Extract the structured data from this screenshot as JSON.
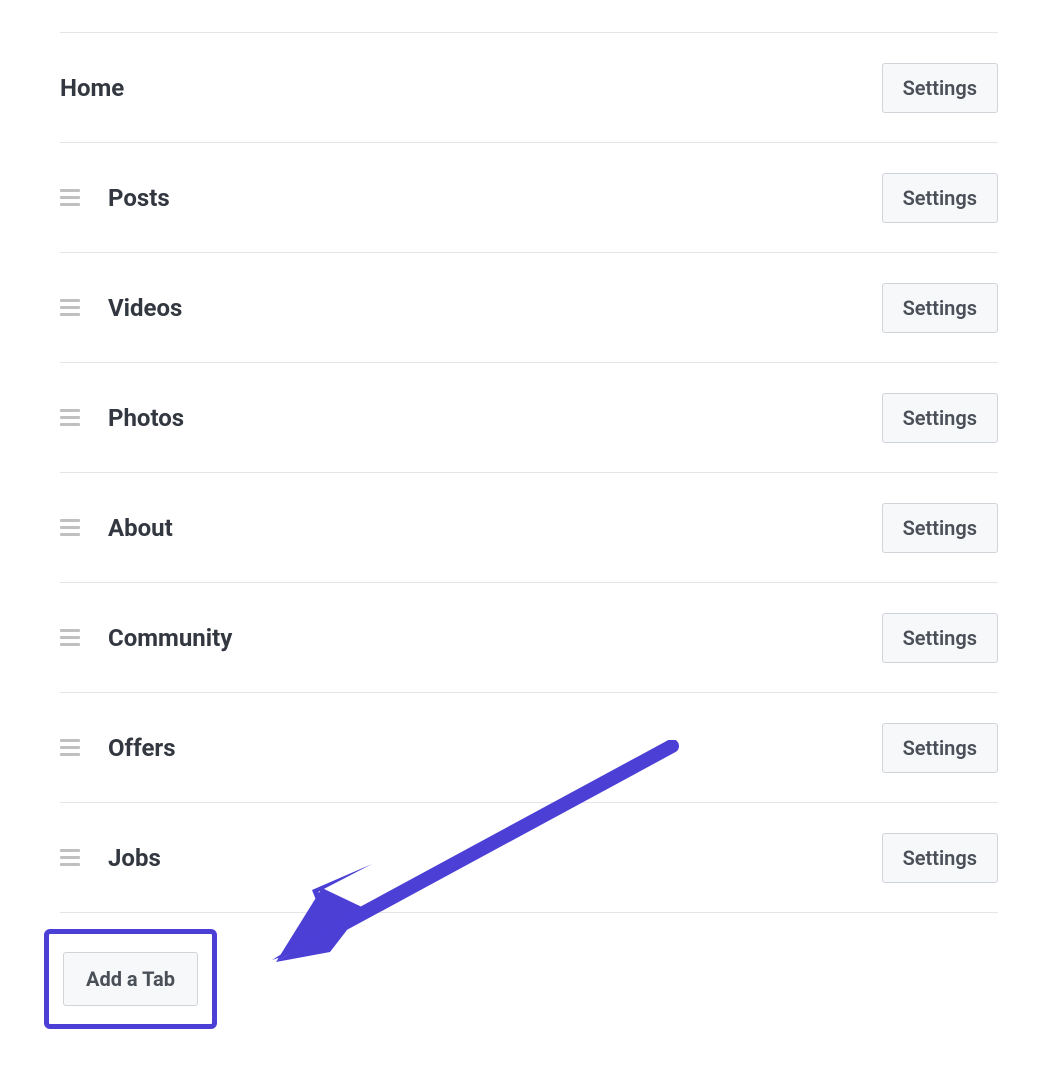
{
  "tabs": [
    {
      "label": "Home",
      "hasHandle": false
    },
    {
      "label": "Posts",
      "hasHandle": true
    },
    {
      "label": "Videos",
      "hasHandle": true
    },
    {
      "label": "Photos",
      "hasHandle": true
    },
    {
      "label": "About",
      "hasHandle": true
    },
    {
      "label": "Community",
      "hasHandle": true
    },
    {
      "label": "Offers",
      "hasHandle": true
    },
    {
      "label": "Jobs",
      "hasHandle": true
    }
  ],
  "settingsLabel": "Settings",
  "addTabLabel": "Add a Tab",
  "annotation": {
    "color": "#4b3fd6"
  }
}
